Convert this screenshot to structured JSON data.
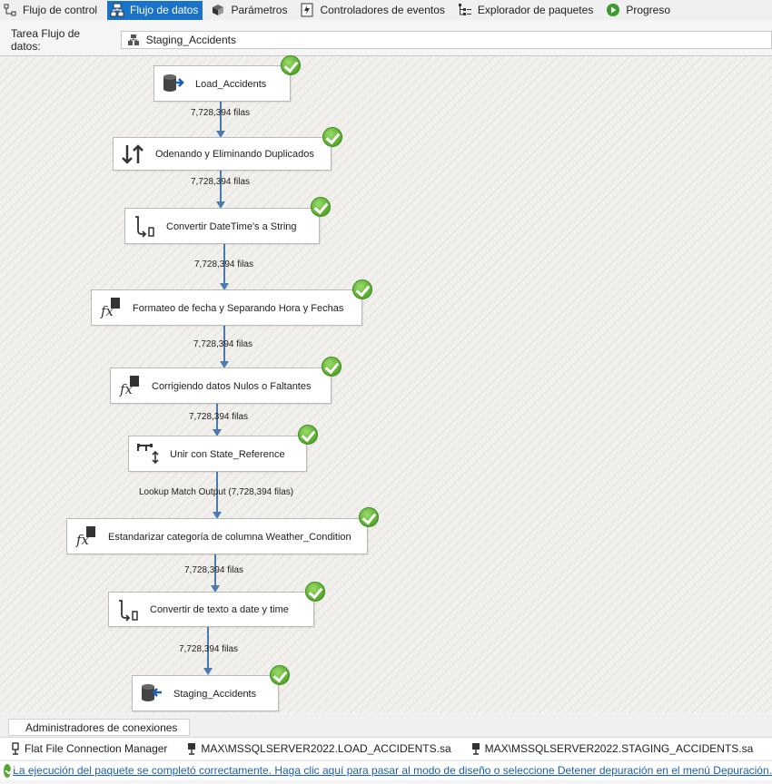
{
  "tabs": [
    {
      "label": "Flujo de control",
      "icon": "control-flow-icon",
      "active": false
    },
    {
      "label": "Flujo de datos",
      "icon": "data-flow-icon",
      "active": true
    },
    {
      "label": "Parámetros",
      "icon": "parameters-icon",
      "active": false
    },
    {
      "label": "Controladores de eventos",
      "icon": "event-handlers-icon",
      "active": false
    },
    {
      "label": "Explorador de paquetes",
      "icon": "package-explorer-icon",
      "active": false
    },
    {
      "label": "Progreso",
      "icon": "progress-icon",
      "active": false
    }
  ],
  "task": {
    "label": "Tarea Flujo de datos:",
    "value": "Staging_Accidents"
  },
  "components": [
    {
      "name": "Load_Accidents",
      "icon": "source-icon"
    },
    {
      "name": "Odenando y Eliminando Duplicados",
      "icon": "sort-icon"
    },
    {
      "name": "Convertir DateTime's a String",
      "icon": "data-conversion-icon"
    },
    {
      "name": "Formateo de fecha y Separando Hora y Fechas",
      "icon": "derived-column-icon"
    },
    {
      "name": "Corrigiendo datos Nulos o Faltantes",
      "icon": "derived-column-icon"
    },
    {
      "name": "Unir con State_Reference",
      "icon": "lookup-icon"
    },
    {
      "name": "Estandarizar categoría de columna Weather_Condition",
      "icon": "derived-column-icon"
    },
    {
      "name": "Convertir de texto a date y time",
      "icon": "data-conversion-icon"
    },
    {
      "name": "Staging_Accidents",
      "icon": "destination-icon"
    }
  ],
  "paths": [
    {
      "label": "7,728,394 filas"
    },
    {
      "label": "7,728,394 filas"
    },
    {
      "label": "7,728,394 filas"
    },
    {
      "label": "7,728,394 filas"
    },
    {
      "label": "7,728,394 filas"
    },
    {
      "label": "Lookup Match Output (7,728,394 filas)"
    },
    {
      "label": "7,728,394 filas"
    },
    {
      "label": "7,728,394 filas"
    }
  ],
  "connections_tab": "Administradores de conexiones",
  "connections": [
    {
      "label": "Flat File Connection Manager"
    },
    {
      "label": "MAX\\MSSQLSERVER2022.LOAD_ACCIDENTS.sa"
    },
    {
      "label": "MAX\\MSSQLSERVER2022.STAGING_ACCIDENTS.sa"
    }
  ],
  "status": {
    "message": "La ejecución del paquete se completó correctamente. Haga clic aquí para pasar al modo de diseño o seleccione Detener depuración en el menú Depuración.",
    "state": "success"
  },
  "colors": {
    "active_tab": "#1a73c8",
    "path": "#4a7bb0",
    "success": "#55a82b",
    "link": "#1a5fb4"
  }
}
